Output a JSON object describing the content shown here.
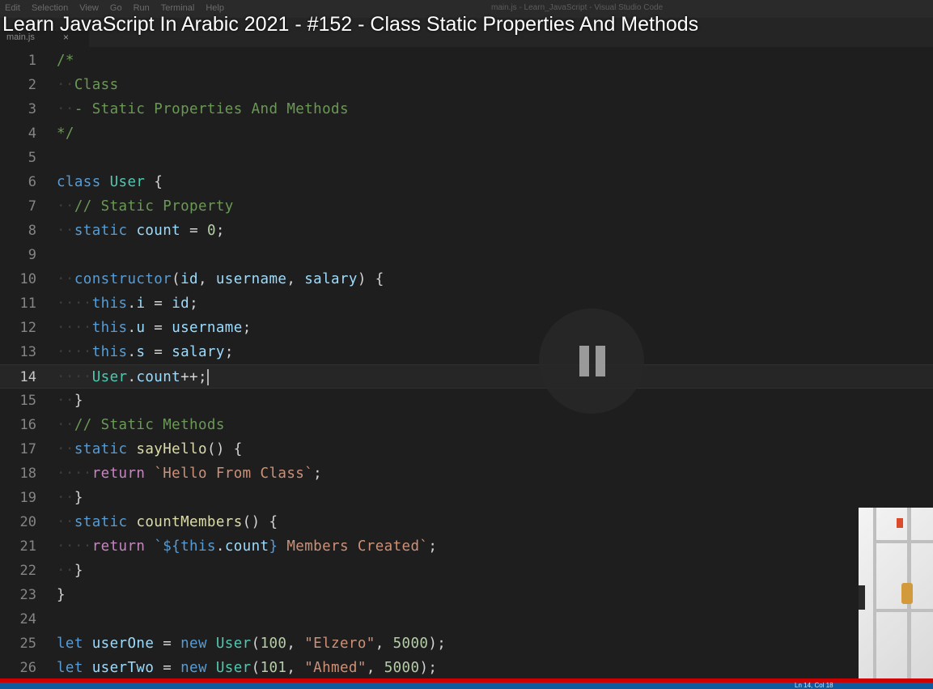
{
  "menubar": {
    "items": [
      "Edit",
      "Selection",
      "View",
      "Go",
      "Run",
      "Terminal",
      "Help"
    ],
    "window_title": "main.js - Learn_JavaScript - Visual Studio Code"
  },
  "tab": {
    "label": "main.js",
    "close_glyph": "×"
  },
  "video": {
    "title": "Learn JavaScript In Arabic 2021 - #152 - Class Static Properties And Methods",
    "state_icon": "pause-icon"
  },
  "editor": {
    "current_line": 14,
    "lines": [
      {
        "n": "1"
      },
      {
        "n": "2"
      },
      {
        "n": "3"
      },
      {
        "n": "4"
      },
      {
        "n": "5"
      },
      {
        "n": "6"
      },
      {
        "n": "7"
      },
      {
        "n": "8"
      },
      {
        "n": "9"
      },
      {
        "n": "10"
      },
      {
        "n": "11"
      },
      {
        "n": "12"
      },
      {
        "n": "13"
      },
      {
        "n": "14"
      },
      {
        "n": "15"
      },
      {
        "n": "16"
      },
      {
        "n": "17"
      },
      {
        "n": "18"
      },
      {
        "n": "19"
      },
      {
        "n": "20"
      },
      {
        "n": "21"
      },
      {
        "n": "22"
      },
      {
        "n": "23"
      },
      {
        "n": "24"
      },
      {
        "n": "25"
      },
      {
        "n": "26"
      }
    ],
    "code": {
      "l1": "/*",
      "l2": "Class",
      "l3": "- Static Properties And Methods",
      "l4": "*/",
      "l6_kw": "class",
      "l6_cls": "User",
      "l6_brace": "{",
      "l7": "// Static Property",
      "l8_kw": "static",
      "l8_var": "count",
      "l8_eq": "=",
      "l8_num": "0",
      "l8_end": ";",
      "l10_fn": "constructor",
      "l10_open": "(",
      "l10_p1": "id",
      "l10_p2": "username",
      "l10_p3": "salary",
      "l10_close": ")",
      "l10_brace": "{",
      "l11_this": "this",
      "l11_prop": "i",
      "l11_val": "id",
      "l12_this": "this",
      "l12_prop": "u",
      "l12_val": "username",
      "l13_this": "this",
      "l13_prop": "s",
      "l13_val": "salary",
      "l14_cls": "User",
      "l14_prop": "count",
      "l14_op": "++;",
      "l15": "}",
      "l16": "// Static Methods",
      "l17_kw": "static",
      "l17_fn": "sayHello",
      "l17_rest": "() {",
      "l18_kw": "return",
      "l18_str": "`Hello From Class`",
      "l18_end": ";",
      "l19": "}",
      "l20_kw": "static",
      "l20_fn": "countMembers",
      "l20_rest": "() {",
      "l21_kw": "return",
      "l21_str1": "`${",
      "l21_this": "this",
      "l21_prop": "count",
      "l21_str2": "}",
      "l21_str3": " Members Created`",
      "l21_end": ";",
      "l22": "}",
      "l23": "}",
      "l25_kw": "let",
      "l25_var": "userOne",
      "l25_eq": "=",
      "l25_new": "new",
      "l25_cls": "User",
      "l25_n1": "100",
      "l25_s": "\"Elzero\"",
      "l25_n2": "5000",
      "l25_end": ");",
      "l26_kw": "let",
      "l26_var": "userTwo",
      "l26_eq": "=",
      "l26_new": "new",
      "l26_cls": "User",
      "l26_n1": "101",
      "l26_s": "\"Ahmed\"",
      "l26_n2": "5000",
      "l26_end": ");"
    }
  },
  "statusbar": {
    "position": "Ln 14, Col 18"
  },
  "colors": {
    "accent_progress": "#cc0000",
    "statusbar": "#0e5a9e"
  }
}
